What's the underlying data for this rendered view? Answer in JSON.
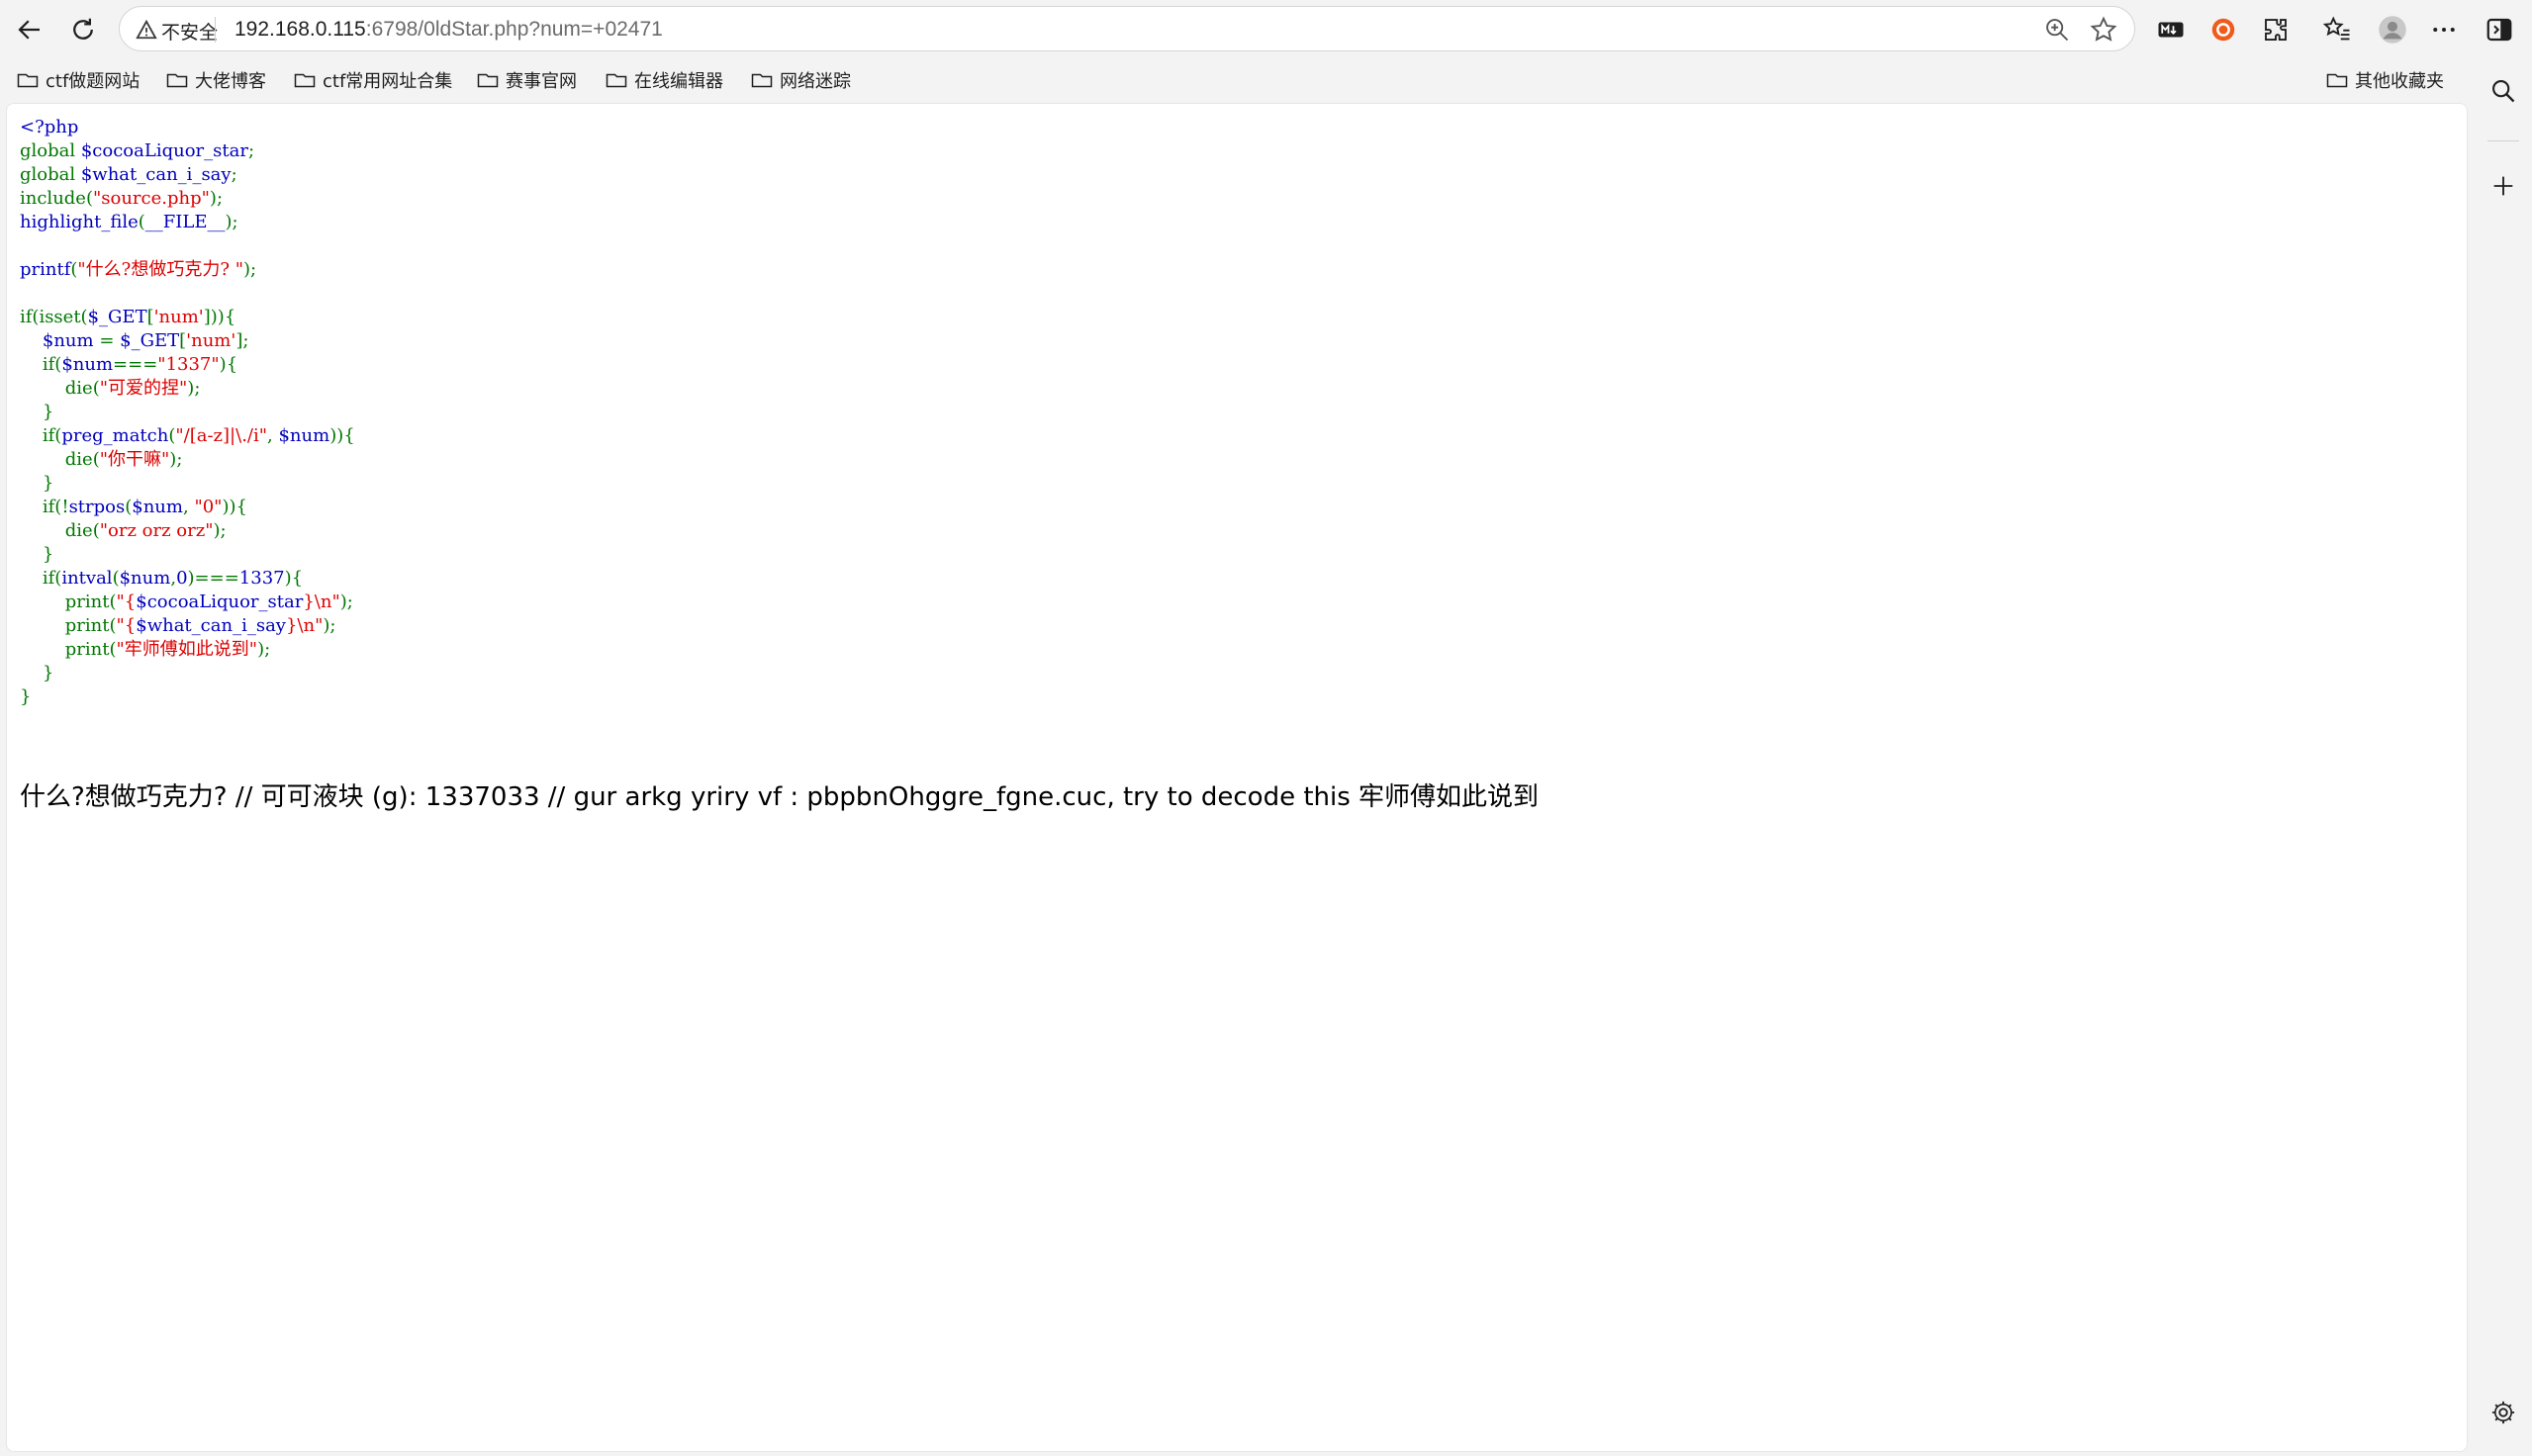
{
  "browser": {
    "insecure_label": "不安全",
    "url_host": "192.168.0.115",
    "url_path": ":6798/0ldStar.php?num=+02471"
  },
  "bookmarks": [
    {
      "label": "ctf做题网站"
    },
    {
      "label": "大佬博客"
    },
    {
      "label": "ctf常用网址合集"
    },
    {
      "label": "赛事官网"
    },
    {
      "label": "在线编辑器"
    },
    {
      "label": "网络迷踪"
    }
  ],
  "other_bookmarks": "其他收藏夹",
  "code_lines": [
    [
      {
        "c": "kw",
        "t": "<?php"
      }
    ],
    [
      {
        "c": "pu",
        "t": "global "
      },
      {
        "c": "kw",
        "t": "$cocoaLiquor_star"
      },
      {
        "c": "pu",
        "t": ";"
      }
    ],
    [
      {
        "c": "pu",
        "t": "global "
      },
      {
        "c": "kw",
        "t": "$what_can_i_say"
      },
      {
        "c": "pu",
        "t": ";"
      }
    ],
    [
      {
        "c": "pu",
        "t": "include("
      },
      {
        "c": "st",
        "t": "\"source.php\""
      },
      {
        "c": "pu",
        "t": ");"
      }
    ],
    [
      {
        "c": "kw",
        "t": "highlight_file"
      },
      {
        "c": "pu",
        "t": "("
      },
      {
        "c": "kw",
        "t": "__FILE__"
      },
      {
        "c": "pu",
        "t": ");"
      }
    ],
    [],
    [
      {
        "c": "kw",
        "t": "printf"
      },
      {
        "c": "pu",
        "t": "("
      },
      {
        "c": "st",
        "t": "\"什么?想做巧克力? \""
      },
      {
        "c": "pu",
        "t": ");"
      }
    ],
    [],
    [
      {
        "c": "pu",
        "t": "if(isset("
      },
      {
        "c": "kw",
        "t": "$_GET"
      },
      {
        "c": "pu",
        "t": "["
      },
      {
        "c": "st",
        "t": "'num'"
      },
      {
        "c": "pu",
        "t": "])){"
      }
    ],
    [
      {
        "c": "pu",
        "t": "    "
      },
      {
        "c": "kw",
        "t": "$num "
      },
      {
        "c": "pu",
        "t": "= "
      },
      {
        "c": "kw",
        "t": "$_GET"
      },
      {
        "c": "pu",
        "t": "["
      },
      {
        "c": "st",
        "t": "'num'"
      },
      {
        "c": "pu",
        "t": "];"
      }
    ],
    [
      {
        "c": "pu",
        "t": "    if("
      },
      {
        "c": "kw",
        "t": "$num"
      },
      {
        "c": "pu",
        "t": "==="
      },
      {
        "c": "st",
        "t": "\"1337\""
      },
      {
        "c": "pu",
        "t": "){"
      }
    ],
    [
      {
        "c": "pu",
        "t": "        die("
      },
      {
        "c": "st",
        "t": "\"可爱的捏\""
      },
      {
        "c": "pu",
        "t": ");"
      }
    ],
    [
      {
        "c": "pu",
        "t": "    }"
      }
    ],
    [
      {
        "c": "pu",
        "t": "    if("
      },
      {
        "c": "kw",
        "t": "preg_match"
      },
      {
        "c": "pu",
        "t": "("
      },
      {
        "c": "st",
        "t": "\"/[a-z]|\\./i\""
      },
      {
        "c": "pu",
        "t": ", "
      },
      {
        "c": "kw",
        "t": "$num"
      },
      {
        "c": "pu",
        "t": ")){"
      }
    ],
    [
      {
        "c": "pu",
        "t": "        die("
      },
      {
        "c": "st",
        "t": "\"你干嘛\""
      },
      {
        "c": "pu",
        "t": ");"
      }
    ],
    [
      {
        "c": "pu",
        "t": "    }"
      }
    ],
    [
      {
        "c": "pu",
        "t": "    if(!"
      },
      {
        "c": "kw",
        "t": "strpos"
      },
      {
        "c": "pu",
        "t": "("
      },
      {
        "c": "kw",
        "t": "$num"
      },
      {
        "c": "pu",
        "t": ", "
      },
      {
        "c": "st",
        "t": "\"0\""
      },
      {
        "c": "pu",
        "t": ")){"
      }
    ],
    [
      {
        "c": "pu",
        "t": "        die("
      },
      {
        "c": "st",
        "t": "\"orz orz orz\""
      },
      {
        "c": "pu",
        "t": ");"
      }
    ],
    [
      {
        "c": "pu",
        "t": "    }"
      }
    ],
    [
      {
        "c": "pu",
        "t": "    if("
      },
      {
        "c": "kw",
        "t": "intval"
      },
      {
        "c": "pu",
        "t": "("
      },
      {
        "c": "kw",
        "t": "$num"
      },
      {
        "c": "pu",
        "t": ","
      },
      {
        "c": "kw",
        "t": "0"
      },
      {
        "c": "pu",
        "t": ")==="
      },
      {
        "c": "kw",
        "t": "1337"
      },
      {
        "c": "pu",
        "t": "){"
      }
    ],
    [
      {
        "c": "pu",
        "t": "        print("
      },
      {
        "c": "st",
        "t": "\"{"
      },
      {
        "c": "kw",
        "t": "$cocoaLiquor_star"
      },
      {
        "c": "st",
        "t": "}\\n\""
      },
      {
        "c": "pu",
        "t": ");"
      }
    ],
    [
      {
        "c": "pu",
        "t": "        print("
      },
      {
        "c": "st",
        "t": "\"{"
      },
      {
        "c": "kw",
        "t": "$what_can_i_say"
      },
      {
        "c": "st",
        "t": "}\\n\""
      },
      {
        "c": "pu",
        "t": ");"
      }
    ],
    [
      {
        "c": "pu",
        "t": "        print("
      },
      {
        "c": "st",
        "t": "\"牢师傅如此说到\""
      },
      {
        "c": "pu",
        "t": ");"
      }
    ],
    [
      {
        "c": "pu",
        "t": "    }"
      }
    ],
    [
      {
        "c": "pu",
        "t": "}"
      }
    ]
  ],
  "output_text": "什么?想做巧克力? // 可可液块 (g): 1337033 // gur arkg yriry vf : pbpbnOhggre_fgne.cuc, try to decode this 牢师傅如此说到"
}
